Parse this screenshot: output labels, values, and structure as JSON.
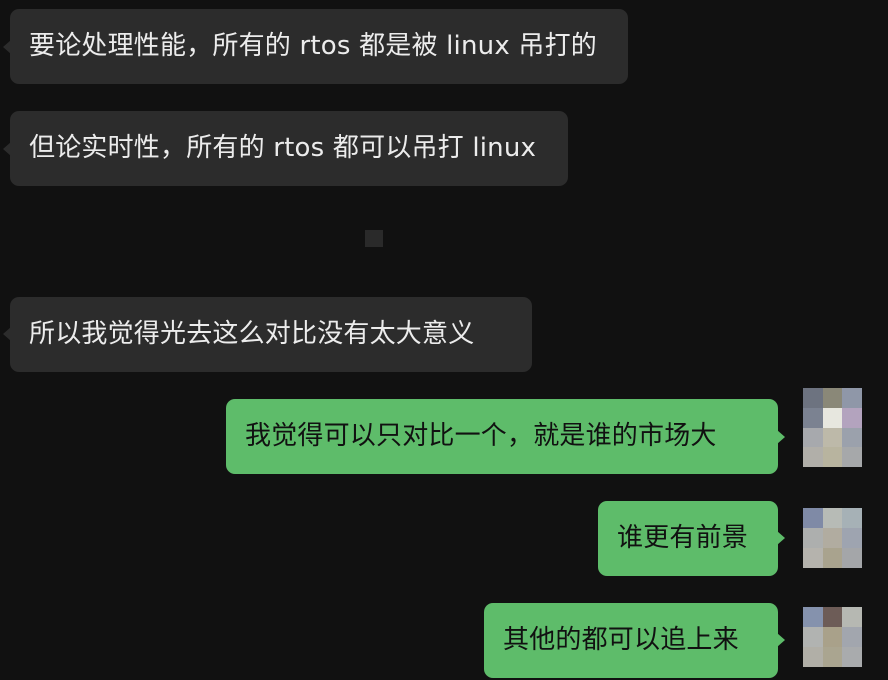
{
  "chat": {
    "messages": [
      {
        "direction": "in",
        "text": "要论处理性能，所有的 rtos 都是被 linux 吊打的"
      },
      {
        "direction": "in",
        "text": "但论实时性，所有的 rtos 都可以吊打 linux"
      },
      {
        "direction": "in",
        "text": "所以我觉得光去这么对比没有太大意义"
      },
      {
        "direction": "out",
        "text": "我觉得可以只对比一个，就是谁的市场大"
      },
      {
        "direction": "out",
        "text": "谁更有前景"
      },
      {
        "direction": "out",
        "text": "其他的都可以追上来"
      }
    ]
  },
  "colors": {
    "background": "#111111",
    "incoming_bubble": "#2c2c2c",
    "incoming_text": "#ececec",
    "outgoing_bubble": "#5ebc6a",
    "outgoing_text": "#111111"
  },
  "avatar": {
    "icon": "pixelated-avatar"
  },
  "placeholder": {
    "icon": "image-loading-placeholder"
  }
}
